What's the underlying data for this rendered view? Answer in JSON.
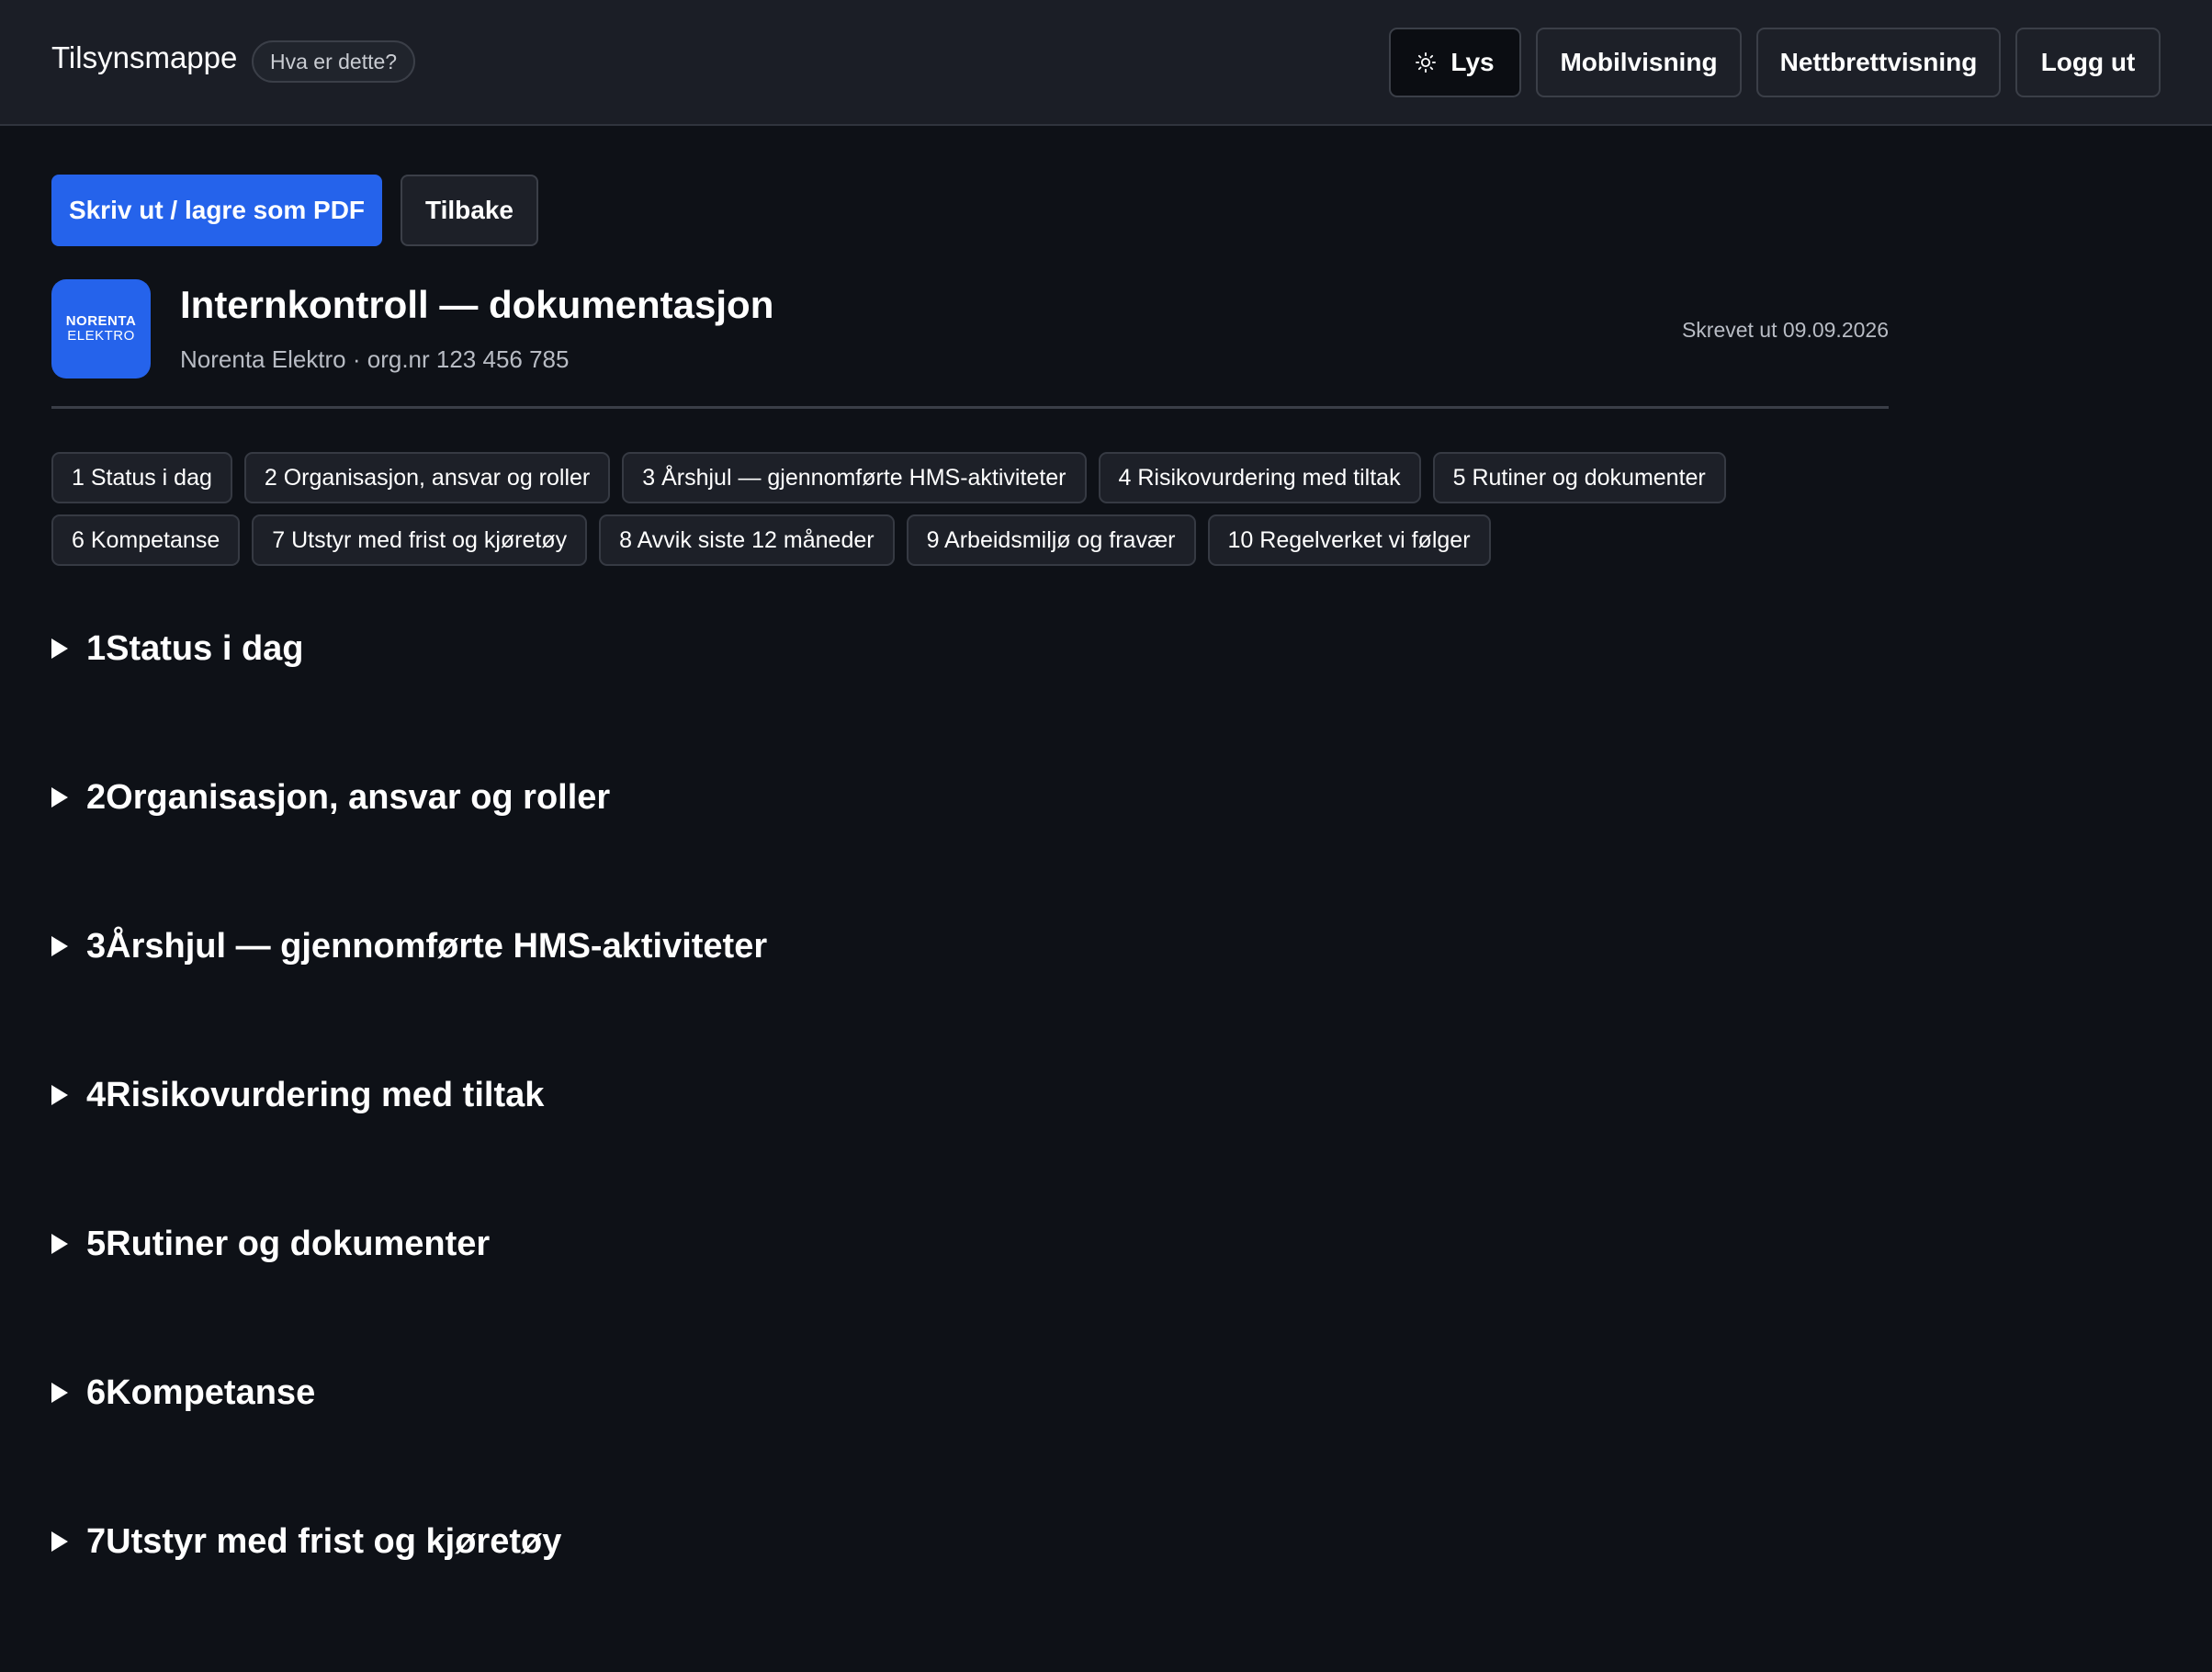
{
  "header": {
    "brand": "Tilsynsmappe",
    "help_chip": "Hva er dette?",
    "theme_button": "Lys",
    "theme_icon": "sun-icon",
    "mobile_button": "Mobilvisning",
    "tablet_button": "Nettbrettvisning",
    "logout_button": "Logg ut"
  },
  "actions": {
    "print_button": "Skriv ut / lagre som PDF",
    "back_button": "Tilbake"
  },
  "document": {
    "logo_line1": "NORENTA",
    "logo_line2": "ELEKTRO",
    "title": "Internkontroll — dokumentasjon",
    "subtitle": "Norenta Elektro · org.nr 123 456 785",
    "printed_date": "Skrevet ut 09.09.2026"
  },
  "toc": {
    "row1": [
      "1 Status i dag",
      "2 Organisasjon, ansvar og roller",
      "3 Årshjul — gjennomførte HMS-aktiviteter",
      "4 Risikovurdering med tiltak",
      "5 Rutiner og dokumenter"
    ],
    "row2": [
      "6 Kompetanse",
      "7 Utstyr med frist og kjøretøy",
      "8 Avvik siste 12 måneder",
      "9 Arbeidsmiljø og fravær",
      "10 Regelverket vi følger"
    ]
  },
  "sections": [
    {
      "num": "1",
      "name": "Status i dag"
    },
    {
      "num": "2",
      "name": "Organisasjon, ansvar og roller"
    },
    {
      "num": "3",
      "name": "Årshjul — gjennomførte HMS-aktiviteter"
    },
    {
      "num": "4",
      "name": "Risikovurdering med tiltak"
    },
    {
      "num": "5",
      "name": "Rutiner og dokumenter"
    },
    {
      "num": "6",
      "name": "Kompetanse"
    },
    {
      "num": "7",
      "name": "Utstyr med frist og kjøretøy"
    }
  ],
  "colors": {
    "background": "#0e1117",
    "topbar": "#1b1e26",
    "primary": "#2563eb"
  }
}
